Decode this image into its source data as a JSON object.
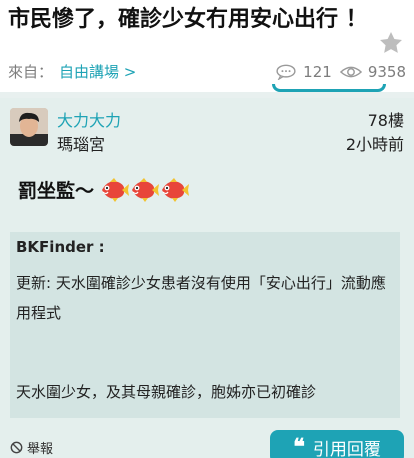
{
  "thread": {
    "title": "市民慘了，確診少女冇用安心出行 ！",
    "from_label": "來自：",
    "forum": "自由講場 >",
    "comments": "121",
    "views": "9358"
  },
  "post": {
    "username": "大力大力",
    "location": "瑪瑙宮",
    "floor": "78樓",
    "time": "2小時前",
    "content": "罰坐監～",
    "quote": {
      "author": "BKFinder :",
      "line1": "更新: 天水圍確診少女患者沒有使用「安心出行」流動應用程式",
      "line2": "天水圍少女，及其母親確診，胞姊亦已初確診"
    },
    "report_label": "舉報",
    "reply_label": "引用回覆",
    "reply_icon_glyph": "❝"
  },
  "colors": {
    "accent": "#1ea3b5",
    "post_bg": "#e4efed",
    "quote_bg": "#d3e4e2"
  }
}
